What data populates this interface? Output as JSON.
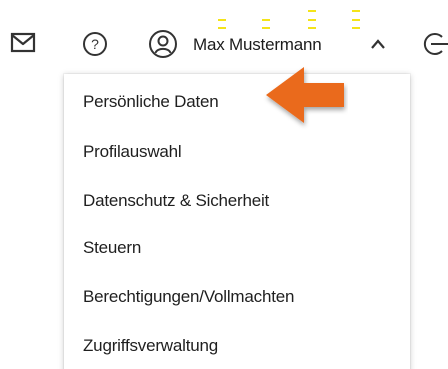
{
  "header": {
    "icons": [
      "mail-icon",
      "help-icon",
      "user-icon",
      "chevron-up-icon",
      "logout-icon"
    ],
    "user_name": "Max Mustermann"
  },
  "menu": {
    "items": [
      {
        "label": "Persönliche Daten"
      },
      {
        "label": "Profilauswahl"
      },
      {
        "label": "Datenschutz & Sicherheit"
      },
      {
        "label": "Steuern"
      },
      {
        "label": "Berechtigungen/Vollmachten"
      },
      {
        "label": "Zugriffsverwaltung"
      }
    ]
  },
  "annotation": {
    "icon": "arrow-left-icon",
    "color": "#ea6a1b",
    "dash_color": "#f4e419"
  }
}
